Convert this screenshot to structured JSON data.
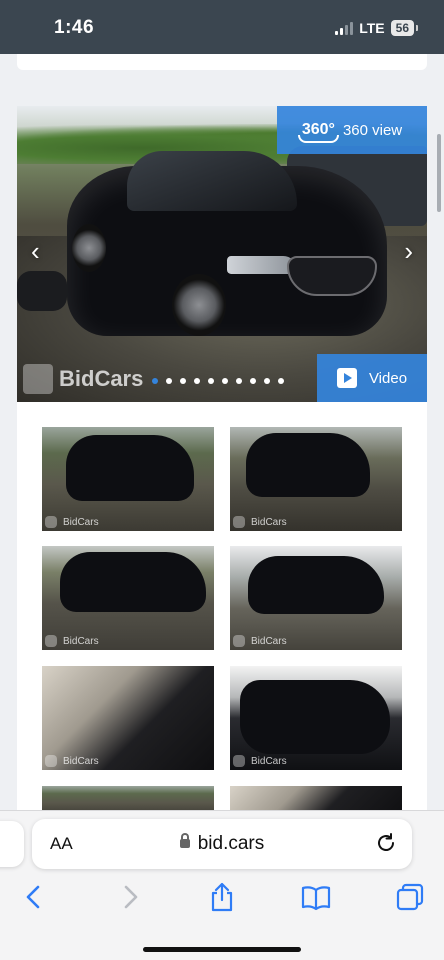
{
  "status_bar": {
    "time": "1:46",
    "network": "LTE",
    "battery": "56"
  },
  "gallery": {
    "badge_360_icon_text": "360°",
    "badge_360_label": "360 view",
    "video_label": "Video",
    "watermark": "BidCars",
    "slide_count": 10,
    "active_slide": 1,
    "thumbnails": [
      {
        "watermark": "BidCars"
      },
      {
        "watermark": "BidCars"
      },
      {
        "watermark": "BidCars"
      },
      {
        "watermark": "BidCars"
      },
      {
        "watermark": "BidCars"
      },
      {
        "watermark": "BidCars"
      }
    ]
  },
  "browser": {
    "text_size_label": "AA",
    "url": "bid.cars"
  },
  "colors": {
    "accent": "#3484dc",
    "status_bar_bg": "#3b4650"
  }
}
